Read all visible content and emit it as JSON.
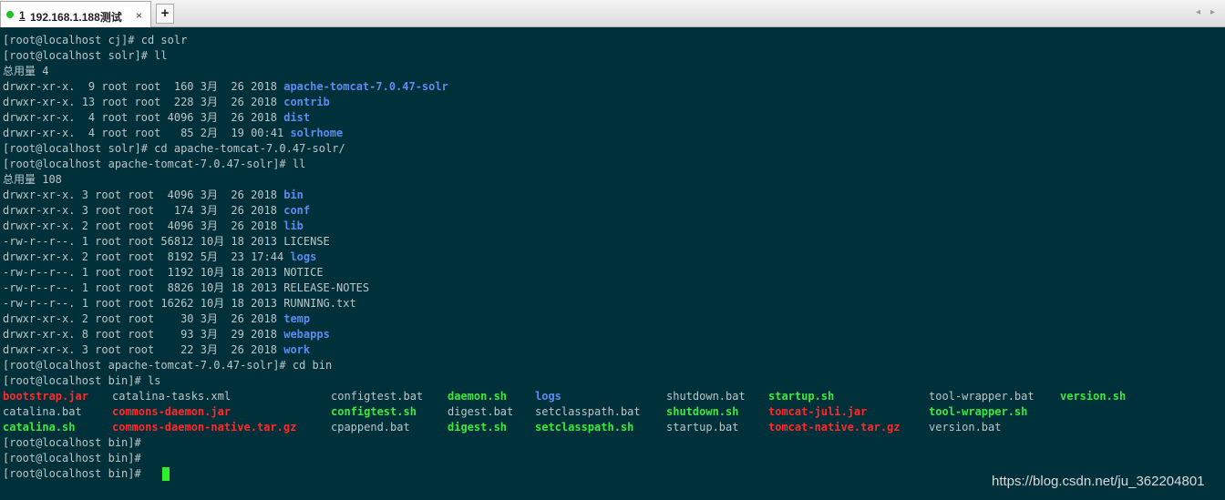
{
  "tab": {
    "number": "1",
    "title": "192.168.1.188测试",
    "close": "×",
    "status_color": "#1fc22a"
  },
  "toolbar": {
    "add_tab": "+",
    "nav_left": "◂",
    "nav_right": "▸"
  },
  "terminal": {
    "lines": [
      {
        "text": "[root@localhost cj]# cd solr"
      },
      {
        "text": "[root@localhost solr]# ll"
      },
      {
        "text": "总用量 4"
      },
      {
        "text": "drwxr-xr-x.  9 root root  160 3月  26 2018 ",
        "name": "apache-tomcat-7.0.47-solr"
      },
      {
        "text": "drwxr-xr-x. 13 root root  228 3月  26 2018 ",
        "name": "contrib"
      },
      {
        "text": "drwxr-xr-x.  4 root root 4096 3月  26 2018 ",
        "name": "dist"
      },
      {
        "text": "drwxr-xr-x.  4 root root   85 2月  19 00:41 ",
        "name": "solrhome"
      },
      {
        "text": "[root@localhost solr]# cd apache-tomcat-7.0.47-solr/"
      },
      {
        "text": "[root@localhost apache-tomcat-7.0.47-solr]# ll"
      },
      {
        "text": "总用量 108"
      },
      {
        "text": "drwxr-xr-x. 3 root root  4096 3月  26 2018 ",
        "name": "bin"
      },
      {
        "text": "drwxr-xr-x. 3 root root   174 3月  26 2018 ",
        "name": "conf"
      },
      {
        "text": "drwxr-xr-x. 2 root root  4096 3月  26 2018 ",
        "name": "lib"
      },
      {
        "text": "-rw-r--r--. 1 root root 56812 10月 18 2013 LICENSE"
      },
      {
        "text": "drwxr-xr-x. 2 root root  8192 5月  23 17:44 ",
        "name": "logs"
      },
      {
        "text": "-rw-r--r--. 1 root root  1192 10月 18 2013 NOTICE"
      },
      {
        "text": "-rw-r--r--. 1 root root  8826 10月 18 2013 RELEASE-NOTES"
      },
      {
        "text": "-rw-r--r--. 1 root root 16262 10月 18 2013 RUNNING.txt"
      },
      {
        "text": "drwxr-xr-x. 2 root root    30 3月  26 2018 ",
        "name": "temp"
      },
      {
        "text": "drwxr-xr-x. 8 root root    93 3月  29 2018 ",
        "name": "webapps"
      },
      {
        "text": "drwxr-xr-x. 3 root root    22 3月  26 2018 ",
        "name": "work"
      },
      {
        "text": "[root@localhost apache-tomcat-7.0.47-solr]# cd bin"
      },
      {
        "text": "[root@localhost bin]# ls"
      }
    ],
    "ls_rows": [
      [
        {
          "text": "bootstrap.jar",
          "kind": "red"
        },
        {
          "text": "catalina-tasks.xml",
          "kind": "plain"
        },
        {
          "text": "configtest.bat",
          "kind": "plain"
        },
        {
          "text": "daemon.sh",
          "kind": "green"
        },
        {
          "text": "logs",
          "kind": "blue"
        },
        {
          "text": "shutdown.bat",
          "kind": "plain"
        },
        {
          "text": "startup.sh",
          "kind": "green"
        },
        {
          "text": "tool-wrapper.bat",
          "kind": "plain"
        },
        {
          "text": "version.sh",
          "kind": "green"
        }
      ],
      [
        {
          "text": "catalina.bat",
          "kind": "plain"
        },
        {
          "text": "commons-daemon.jar",
          "kind": "red"
        },
        {
          "text": "configtest.sh",
          "kind": "green"
        },
        {
          "text": "digest.bat",
          "kind": "plain"
        },
        {
          "text": "setclasspath.bat",
          "kind": "plain"
        },
        {
          "text": "shutdown.sh",
          "kind": "green"
        },
        {
          "text": "tomcat-juli.jar",
          "kind": "red"
        },
        {
          "text": "tool-wrapper.sh",
          "kind": "green"
        }
      ],
      [
        {
          "text": "catalina.sh",
          "kind": "green"
        },
        {
          "text": "commons-daemon-native.tar.gz",
          "kind": "red"
        },
        {
          "text": "cpappend.bat",
          "kind": "plain"
        },
        {
          "text": "digest.sh",
          "kind": "green"
        },
        {
          "text": "setclasspath.sh",
          "kind": "green"
        },
        {
          "text": "startup.bat",
          "kind": "plain"
        },
        {
          "text": "tomcat-native.tar.gz",
          "kind": "red"
        },
        {
          "text": "version.bat",
          "kind": "plain"
        }
      ]
    ],
    "prompts": [
      "[root@localhost bin]#",
      "[root@localhost bin]#",
      "[root@localhost bin]# "
    ],
    "colors": {
      "background": "#00303a",
      "text": "#bcc6c8",
      "directory": "#5c8cf0",
      "archive": "#ff2a2a",
      "executable": "#3ee83e",
      "cursor": "#2cf02c"
    }
  },
  "watermark": "https://blog.csdn.net/ju_362204801"
}
